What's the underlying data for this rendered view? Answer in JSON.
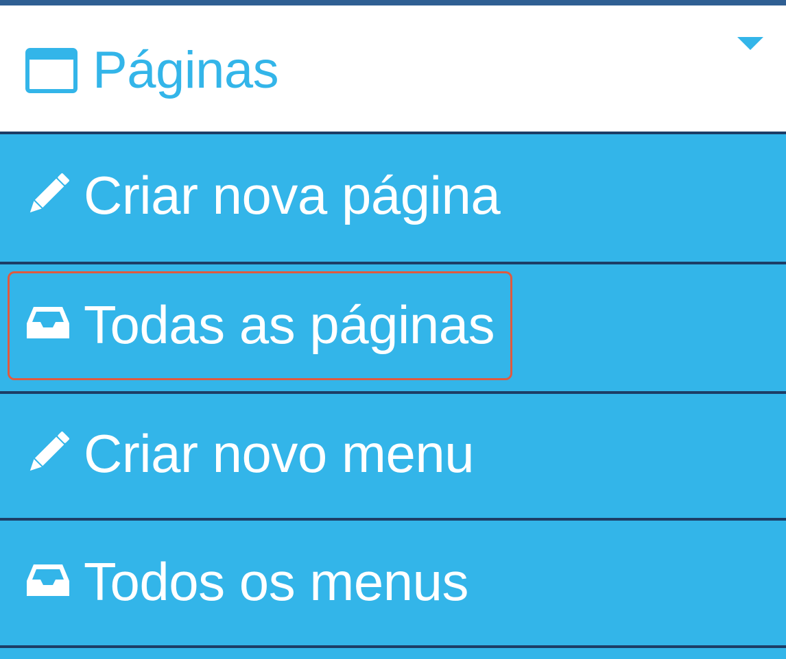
{
  "menu": {
    "header": {
      "label": "Páginas",
      "icon": "window-icon",
      "caret_icon": "caret-down-icon"
    },
    "items": [
      {
        "label": "Criar nova página",
        "icon": "pencil-icon"
      },
      {
        "label": "Todas as páginas",
        "icon": "inbox-icon",
        "highlighted": true
      },
      {
        "label": "Criar novo menu",
        "icon": "pencil-icon"
      },
      {
        "label": "Todos os menus",
        "icon": "inbox-icon"
      }
    ]
  },
  "colors": {
    "accent": "#33b5e9",
    "divider": "#1c3d66",
    "header_bg": "#ffffff",
    "highlight": "#e05a3f"
  }
}
